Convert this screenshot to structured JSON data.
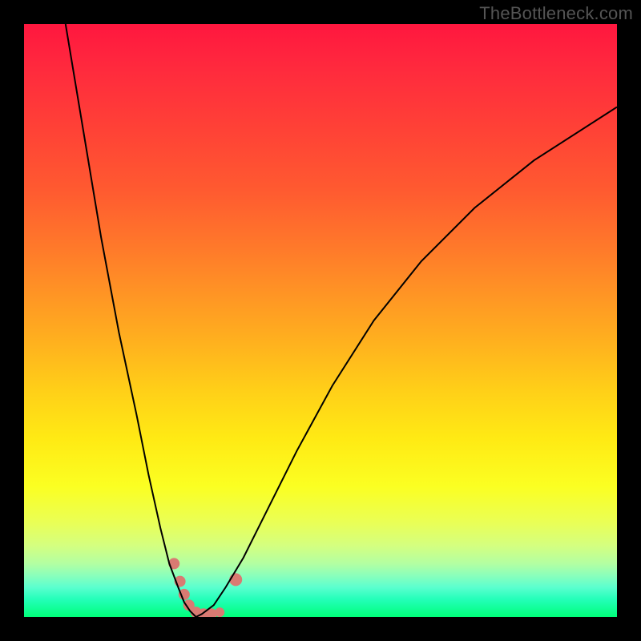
{
  "watermark": "TheBottleneck.com",
  "chart_data": {
    "type": "line",
    "title": "",
    "xlabel": "",
    "ylabel": "",
    "xlim": [
      0,
      100
    ],
    "ylim": [
      0,
      100
    ],
    "grid": false,
    "legend": false,
    "series": [
      {
        "name": "curve-left",
        "x": [
          7,
          10,
          13,
          16,
          19,
          21,
          23,
          24.5,
          26,
          27,
          28,
          29
        ],
        "y": [
          100,
          82,
          64,
          48,
          34,
          24,
          15,
          9,
          5,
          2.5,
          1,
          0
        ]
      },
      {
        "name": "curve-right",
        "x": [
          29,
          30,
          32,
          34,
          37,
          41,
          46,
          52,
          59,
          67,
          76,
          86,
          100
        ],
        "y": [
          0,
          0.5,
          2,
          5,
          10,
          18,
          28,
          39,
          50,
          60,
          69,
          77,
          86
        ]
      }
    ],
    "markers": [
      {
        "x": 25.3,
        "y": 9.0,
        "r": 7
      },
      {
        "x": 26.3,
        "y": 6.0,
        "r": 7
      },
      {
        "x": 27.0,
        "y": 3.8,
        "r": 7
      },
      {
        "x": 27.8,
        "y": 2.0,
        "r": 7
      },
      {
        "x": 29.0,
        "y": 0.8,
        "r": 7
      },
      {
        "x": 30.3,
        "y": 0.5,
        "r": 7
      },
      {
        "x": 31.6,
        "y": 0.5,
        "r": 7
      },
      {
        "x": 33.0,
        "y": 0.8,
        "r": 6
      },
      {
        "x": 35.7,
        "y": 6.3,
        "r": 8
      }
    ],
    "gradient_stops": [
      {
        "pos": 0.0,
        "color": "#ff173f"
      },
      {
        "pos": 0.5,
        "color": "#ffb21e"
      },
      {
        "pos": 0.78,
        "color": "#fbff22"
      },
      {
        "pos": 1.0,
        "color": "#00ff7a"
      }
    ]
  }
}
